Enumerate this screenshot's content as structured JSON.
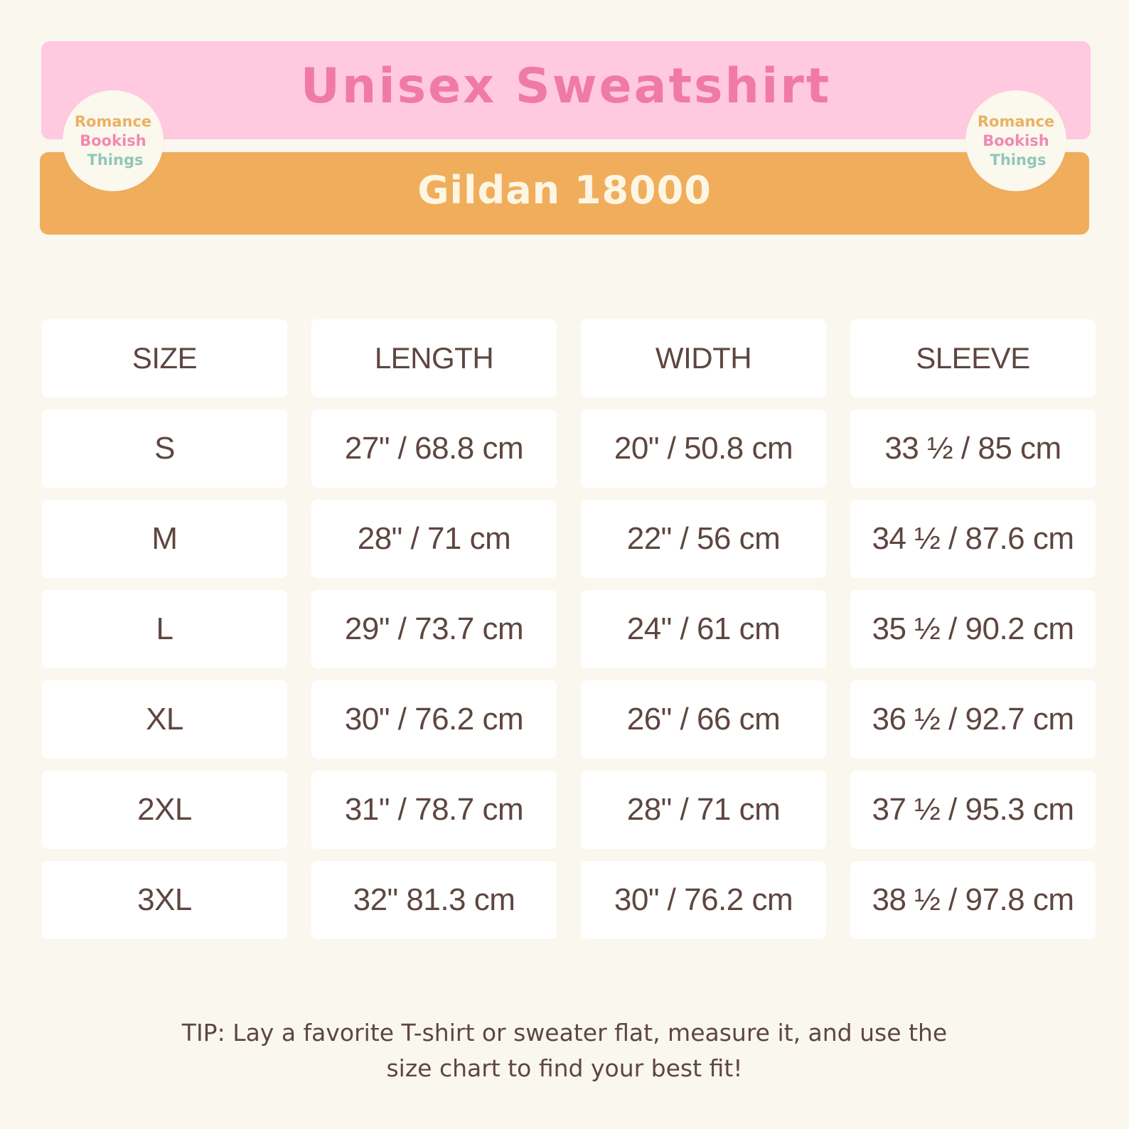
{
  "header": {
    "title": "Unisex Sweatshirt",
    "subtitle": "Gildan 18000",
    "logo": {
      "line1": "Romance",
      "line2": "Bookish",
      "line3": "Things"
    }
  },
  "table": {
    "columns": [
      "SIZE",
      "LENGTH",
      "WIDTH",
      "SLEEVE"
    ],
    "rows": [
      [
        "S",
        "27\" / 68.8 cm",
        "20\" / 50.8 cm",
        "33 ½ / 85 cm"
      ],
      [
        "M",
        "28\" / 71 cm",
        "22\" / 56 cm",
        "34 ½ / 87.6 cm"
      ],
      [
        "L",
        "29\" / 73.7 cm",
        "24\" / 61 cm",
        "35 ½ / 90.2 cm"
      ],
      [
        "XL",
        "30\" / 76.2 cm",
        "26\" / 66 cm",
        "36 ½ / 92.7 cm"
      ],
      [
        "2XL",
        "31\" / 78.7 cm",
        "28\" / 71 cm",
        "37 ½ / 95.3 cm"
      ],
      [
        "3XL",
        "32\" 81.3 cm",
        "30\" / 76.2 cm",
        "38 ½ / 97.8 cm"
      ]
    ]
  },
  "tip": {
    "line1": "TIP: Lay a favorite T-shirt or sweater flat, measure it, and use the",
    "line2": "size chart to find your best fit!"
  },
  "colors": {
    "background": "#faf7ef",
    "pink_banner": "#ffc9df",
    "orange_banner": "#f0ae5c",
    "title": "#f07aa6",
    "text": "#5e4640"
  }
}
